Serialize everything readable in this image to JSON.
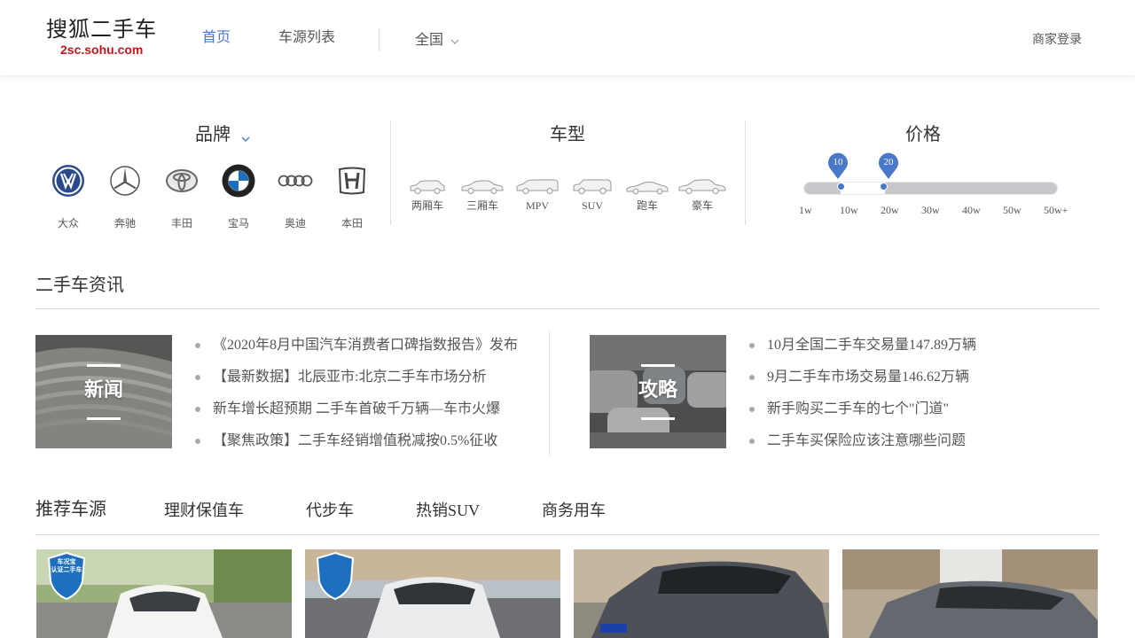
{
  "header": {
    "logo_main": "搜狐二手车",
    "logo_sub": "2sc.sohu.com",
    "nav": [
      "首页",
      "车源列表"
    ],
    "city": "全国",
    "merchant_login": "商家登录"
  },
  "filters": {
    "brand_title": "品牌",
    "cartype_title": "车型",
    "price_title": "价格",
    "brands": [
      "大众",
      "奔驰",
      "丰田",
      "宝马",
      "奥迪",
      "本田"
    ],
    "cartypes": [
      "两厢车",
      "三厢车",
      "MPV",
      "SUV",
      "跑车",
      "豪车"
    ],
    "price": {
      "low": "10",
      "high": "20",
      "ticks": [
        "1w",
        "10w",
        "20w",
        "30w",
        "40w",
        "50w",
        "50w+"
      ]
    }
  },
  "news": {
    "title": "二手车资讯",
    "left_label": "新闻",
    "right_label": "攻略",
    "left_items": [
      "《2020年8月中国汽车消费者口碑指数报告》发布",
      "【最新数据】北辰亚市:北京二手车市场分析",
      "新车增长超预期 二手车首破千万辆—车市火爆",
      "【聚焦政策】二手车经销增值税减按0.5%征收"
    ],
    "right_items": [
      "10月全国二手车交易量147.89万辆",
      "9月二手车市场交易量146.62万辆",
      "新手购买二手车的七个\"门道\"",
      "二手车买保险应该注意哪些问题"
    ]
  },
  "recommend": {
    "tabs": [
      "推荐车源",
      "理财保值车",
      "代步车",
      "热销SUV",
      "商务用车"
    ],
    "badge_line1": "车况宝",
    "badge_line2": "认证二手车"
  },
  "colors": {
    "accent": "#4a78c8",
    "logo_red": "#c4161c"
  }
}
